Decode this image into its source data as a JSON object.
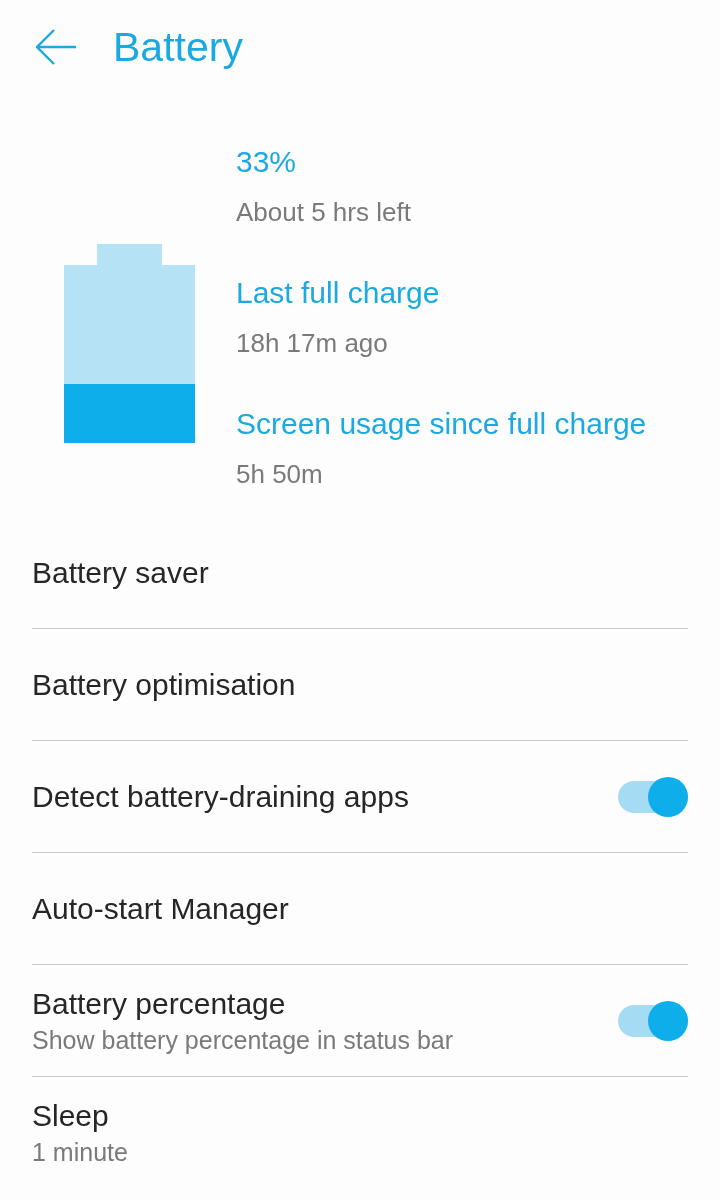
{
  "header": {
    "title": "Battery"
  },
  "summary": {
    "battery": {
      "level": 0.33
    },
    "stats": [
      {
        "title": "33%",
        "detail": "About 5 hrs left"
      },
      {
        "title": "Last full charge",
        "detail": "18h 17m ago"
      },
      {
        "title": "Screen usage since full charge",
        "detail": "5h 50m"
      }
    ]
  },
  "settings": [
    {
      "kind": "plain",
      "title": "Battery saver"
    },
    {
      "kind": "plain",
      "title": "Battery optimisation"
    },
    {
      "kind": "toggle",
      "title": "Detect battery-draining apps",
      "on": true
    },
    {
      "kind": "plain",
      "title": "Auto-start Manager"
    },
    {
      "kind": "toggle",
      "title": "Battery percentage",
      "subtitle": "Show battery percentage in status bar",
      "on": true
    },
    {
      "kind": "plain",
      "title": "Sleep",
      "subtitle": "1 minute"
    }
  ]
}
